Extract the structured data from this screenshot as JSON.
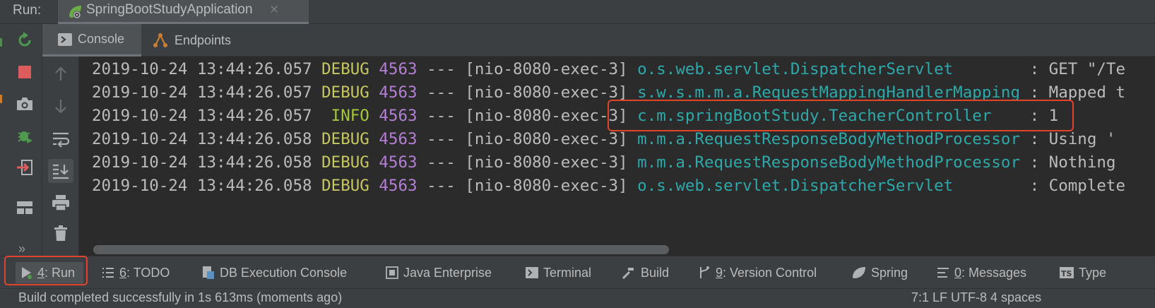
{
  "run_bar": {
    "label": "Run:",
    "tab_title": "SpringBootStudyApplication",
    "tab_icon": "spring-boot-icon",
    "close_glyph": "×"
  },
  "action_toolbar": [
    {
      "name": "rerun-icon",
      "color": "#4e9a4e"
    },
    {
      "name": "stop-icon",
      "color": "#db5c5c"
    },
    {
      "name": "camera-icon",
      "color": "#afb1b3"
    },
    {
      "name": "debug-bug-icon",
      "color": "#4e9a4e"
    },
    {
      "name": "exit-icon",
      "color": "#db5c5c"
    },
    {
      "name": "layout-icon",
      "color": "#afb1b3"
    },
    {
      "name": "more-icon",
      "color": "#9a9da0"
    }
  ],
  "console_header": {
    "tabs": [
      {
        "label": "Console",
        "icon": "console-icon",
        "active": true
      },
      {
        "label": "Endpoints",
        "icon": "endpoints-icon",
        "active": false
      }
    ]
  },
  "console_toolbar": [
    {
      "name": "scroll-up-icon"
    },
    {
      "name": "scroll-down-icon"
    },
    {
      "name": "soft-wrap-icon"
    },
    {
      "name": "scroll-to-end-icon",
      "pressed": true
    },
    {
      "name": "print-icon"
    },
    {
      "name": "clear-all-icon"
    }
  ],
  "console": {
    "lines": [
      {
        "timestamp": "2019-10-24 13:44:26.057",
        "level": "DEBUG",
        "pid": "4563",
        "sep": "---",
        "thread": "[nio-8080-exec-3]",
        "logger": "o.s.web.servlet.DispatcherServlet",
        "message": ": GET \"/Te"
      },
      {
        "timestamp": "2019-10-24 13:44:26.057",
        "level": "DEBUG",
        "pid": "4563",
        "sep": "---",
        "thread": "[nio-8080-exec-3]",
        "logger": "s.w.s.m.m.a.RequestMappingHandlerMapping",
        "message": ": Mapped t"
      },
      {
        "timestamp": "2019-10-24 13:44:26.057",
        "level": " INFO",
        "pid": "4563",
        "sep": "---",
        "thread": "[nio-8080-exec-3]",
        "logger": "c.m.springBootStudy.TeacherController",
        "message": ": 1"
      },
      {
        "timestamp": "2019-10-24 13:44:26.058",
        "level": "DEBUG",
        "pid": "4563",
        "sep": "---",
        "thread": "[nio-8080-exec-3]",
        "logger": "m.m.a.RequestResponseBodyMethodProcessor",
        "message": ": Using '"
      },
      {
        "timestamp": "2019-10-24 13:44:26.058",
        "level": "DEBUG",
        "pid": "4563",
        "sep": "---",
        "thread": "[nio-8080-exec-3]",
        "logger": "m.m.a.RequestResponseBodyMethodProcessor",
        "message": ": Nothing"
      },
      {
        "timestamp": "2019-10-24 13:44:26.058",
        "level": "DEBUG",
        "pid": "4563",
        "sep": "---",
        "thread": "[nio-8080-exec-3]",
        "logger": "o.s.web.servlet.DispatcherServlet",
        "message": ": Complete"
      }
    ]
  },
  "bottom_bar": {
    "windows": [
      {
        "key": "4",
        "label": ": Run",
        "icon": "run-icon",
        "active": true
      },
      {
        "key": "6",
        "label": ": TODO",
        "icon": "todo-icon"
      },
      {
        "key": "",
        "label": "DB Execution Console",
        "icon": "db-console-icon"
      },
      {
        "key": "",
        "label": "Java Enterprise",
        "icon": "java-enterprise-icon"
      },
      {
        "key": "",
        "label": "Terminal",
        "icon": "terminal-icon"
      },
      {
        "key": "",
        "label": "Build",
        "icon": "build-icon"
      },
      {
        "key": "9",
        "label": ": Version Control",
        "icon": "version-control-icon"
      },
      {
        "key": "",
        "label": "Spring",
        "icon": "spring-icon"
      },
      {
        "key": "0",
        "label": ": Messages",
        "icon": "messages-icon"
      },
      {
        "key": "",
        "label": "Type",
        "icon": "typescript-icon"
      }
    ]
  },
  "status_bar": {
    "text": "Build completed successfully in 1s 613ms (moments ago)",
    "right": "7:1  LF  UTF-8  4 spaces"
  },
  "colors": {
    "panel": "#3c3f41",
    "console_bg": "#2b2b2b",
    "debug": "#c7c762",
    "info": "#a3c83a",
    "pid": "#b37fd3",
    "logger": "#2ea8a8",
    "highlight": "#e0452c"
  }
}
